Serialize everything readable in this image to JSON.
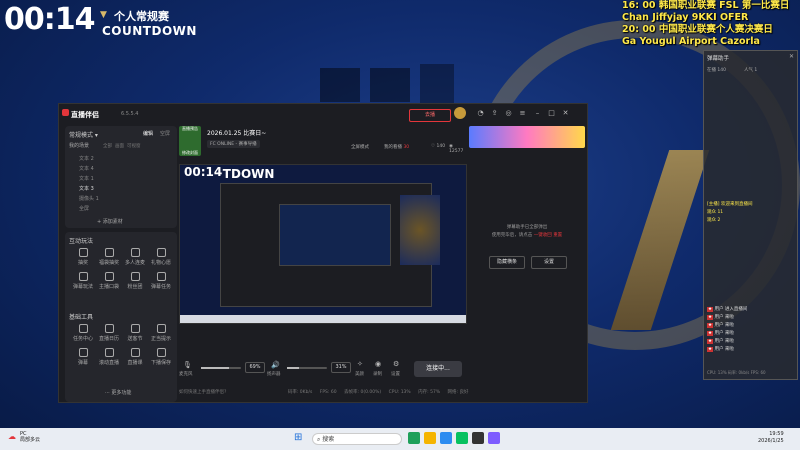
{
  "overlay": {
    "countdown_time": "00:14",
    "event_title": "个人常规赛",
    "countdown_label": "COUNTDOWN",
    "schedule": [
      "16: 00 韩国职业联赛 FSL 第一比赛日",
      "Chan Jiffyjay 9KKI OFER",
      "20: 00 中国职业联赛个人赛决赛日",
      "Ga Yougul Airport Cazorla"
    ]
  },
  "app": {
    "name": "直播伴侣",
    "version": "6.5.5.4",
    "go_live_button": "去播",
    "sidebar": {
      "mode_label": "常规模式 ▾",
      "tab_edit": "编辑",
      "tab_blank": "空屏",
      "scenes_title": "我的场景",
      "scene_tabs": [
        "全部",
        "画面",
        "可视窗"
      ],
      "scenes": [
        "文本 2",
        "文本 4",
        "文本 1",
        "文本 3",
        "摄像头 1",
        "全屏"
      ],
      "add_material": "+ 添加素材",
      "interaction_title": "互动玩法",
      "interaction_tools": [
        "抽奖",
        "福袋抽奖",
        "多人连麦",
        "礼物心愿",
        "弹幕玩法",
        "主播口袋",
        "粉丝团",
        "弹幕任务"
      ],
      "basic_tools_title": "基础工具",
      "basic_tools": [
        "任务中心",
        "直播日历",
        "送客节",
        "正当提示",
        "弹幕",
        "滚动直播",
        "直播课",
        "下播保存"
      ],
      "more_functions": "··· 更多功能"
    },
    "stream": {
      "thumb_text": "直播预告",
      "date_title": "2026.01.25 比赛日~",
      "game_tag": "FC ONLINE - 赛事导播",
      "edit_button": "修改封面",
      "full_screen": "全屏模式",
      "my_reservation": "我的看播",
      "reservation_count": "30",
      "likes": "140",
      "viewers": "12577"
    },
    "preview_countdown": "00:14",
    "preview_countdown_label": "COUNTDOWN",
    "controls": {
      "mic_label": "麦克风",
      "mic_value": "69%",
      "speaker_label": "扬声器",
      "speaker_value": "31%",
      "beauty_label": "美颜",
      "record_label": "录制",
      "settings_label": "设置",
      "connect_button": "连接中..."
    },
    "right_panel": {
      "notice_line1": "弹幕助手已全部弹出",
      "notice_line2": "使用完毕后，请点击",
      "notice_link": "一键收回",
      "notice_after": "重置",
      "hide_button": "隐藏横条",
      "settings_button": "设置"
    },
    "status_bar": {
      "help_text": "如何快速上手直播伴侣?",
      "bitrate": "码率: 0Kb/s",
      "fps": "FPS: 60",
      "dropped": "丢帧率: 0(0.00%)",
      "cpu": "CPU: 13%",
      "memory": "内存: 57%",
      "network": "网络: 良好"
    },
    "toolbar_icons": [
      "bell-icon",
      "share-icon",
      "minimize-icon",
      "maximize-icon",
      "close-icon"
    ]
  },
  "danmu_panel": {
    "title": "弹幕助手",
    "stats": [
      "在播 140",
      "人气 1"
    ],
    "chats": [
      {
        "name": "[主播]",
        "text": "欢迎来到直播间"
      },
      {
        "name": "观众",
        "text": "11"
      },
      {
        "name": "观众",
        "text": "2"
      },
      {
        "name": "用户",
        "text": "进入直播间"
      },
      {
        "name": "用户",
        "text": "来啦"
      },
      {
        "name": "用户",
        "text": "来啦"
      },
      {
        "name": "用户",
        "text": "来啦"
      },
      {
        "name": "用户",
        "text": "来啦"
      },
      {
        "name": "用户",
        "text": "来啦"
      }
    ],
    "footer": "CPU: 13%   码率: 0kb/s   FPS: 60"
  },
  "taskbar": {
    "weather_title": "PC",
    "weather_sub": "局部多云",
    "search_placeholder": "搜索",
    "time": "19:59",
    "date": "2026/1/25"
  },
  "colors": {
    "accent_red": "#e3363b",
    "schedule_yellow": "#ffe94a",
    "gold": "#d8b869"
  }
}
